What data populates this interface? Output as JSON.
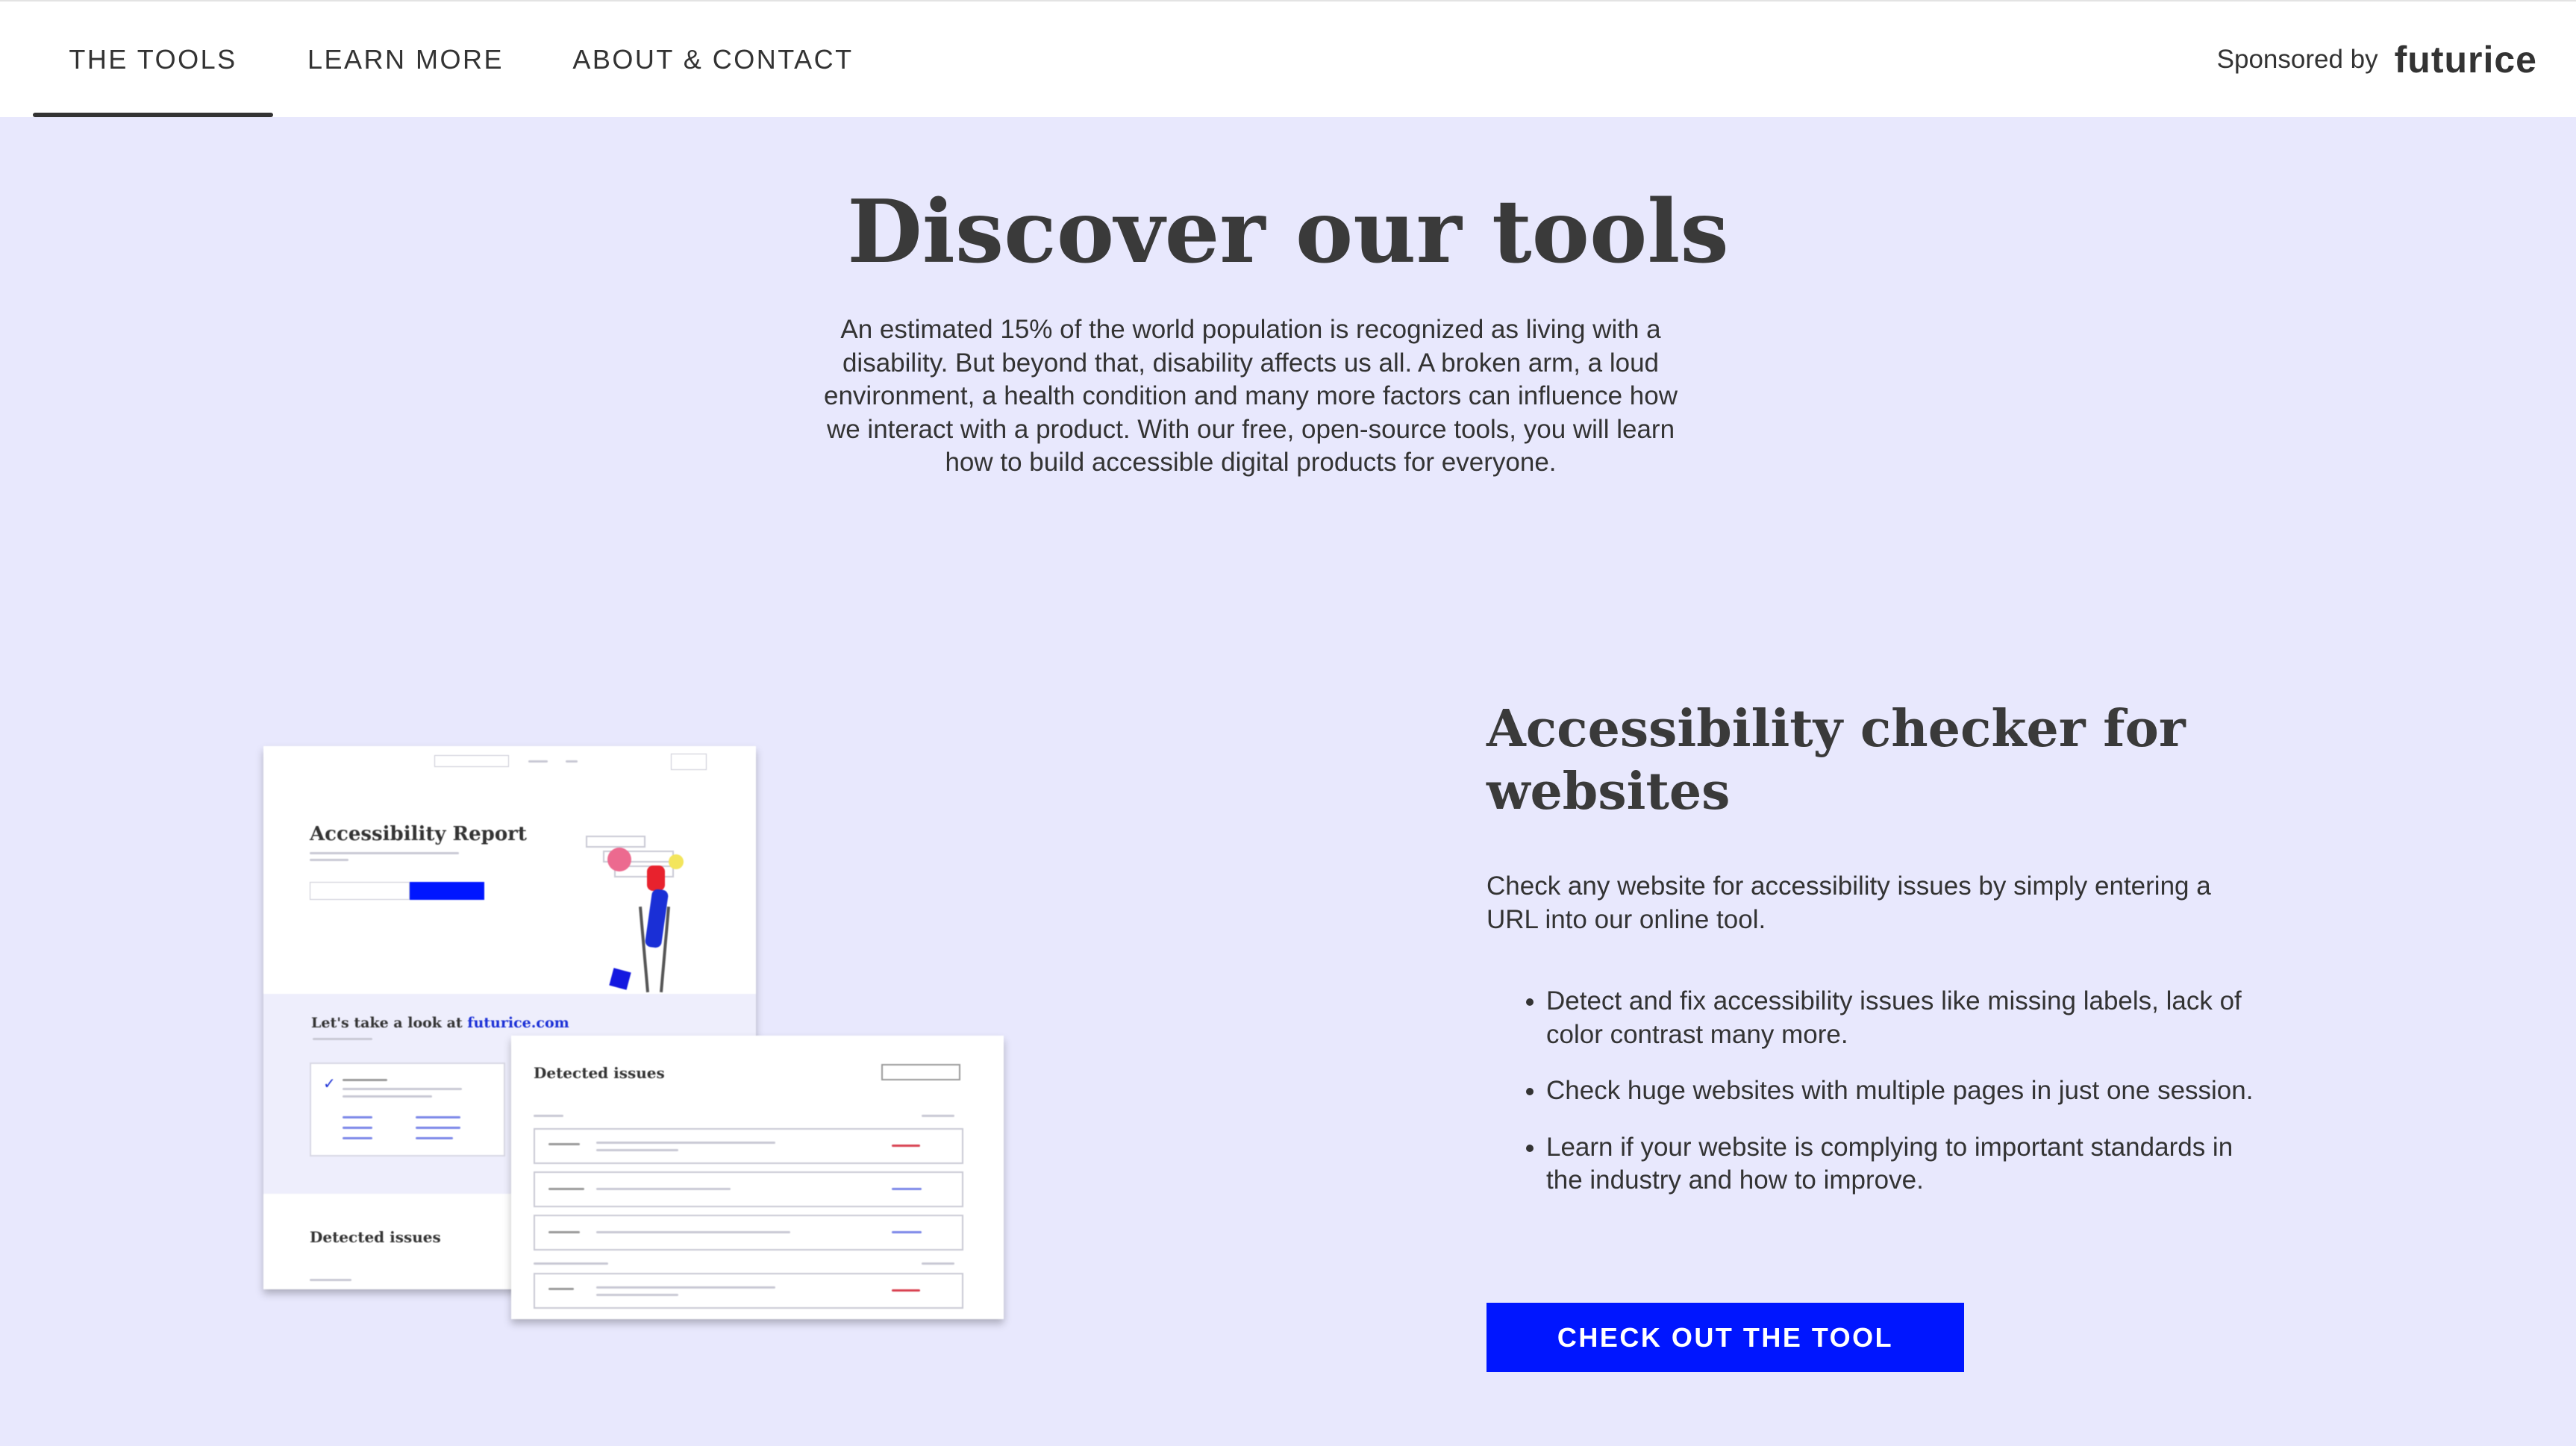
{
  "nav": {
    "tabs": [
      {
        "label": "THE TOOLS",
        "active": true
      },
      {
        "label": "LEARN MORE",
        "active": false
      },
      {
        "label": "ABOUT & CONTACT",
        "active": false
      }
    ],
    "sponsor_label": "Sponsored by",
    "sponsor_logo": "futurice"
  },
  "hero": {
    "title": "Discover our tools",
    "text": "An estimated 15% of the world population is recognized as living with a disability. But beyond that, disability affects us all. A broken arm, a loud environment, a health condition and many more factors can influence how we interact with a product. With our free, open-source tools, you will learn how to build accessible digital products for everyone."
  },
  "feature": {
    "title": "Accessibility checker for websites",
    "description": "Check any website for accessibility issues by simply entering a URL into our online tool.",
    "bullets": [
      "Detect and fix accessibility issues like missing labels, lack of color contrast many more.",
      "Check huge websites with multiple pages in just one session.",
      "Learn if your website is complying to important standards in the industry and how to improve."
    ],
    "cta_label": "CHECK OUT THE TOOL"
  },
  "mockup": {
    "report_title": "Accessibility Report",
    "look_text": "Let's take a look at",
    "look_link": "futurice.com",
    "detected_back": "Detected issues",
    "detected_front": "Detected issues"
  },
  "colors": {
    "background": "#e8e8fd",
    "accent": "#0016ff",
    "text": "#333333"
  }
}
